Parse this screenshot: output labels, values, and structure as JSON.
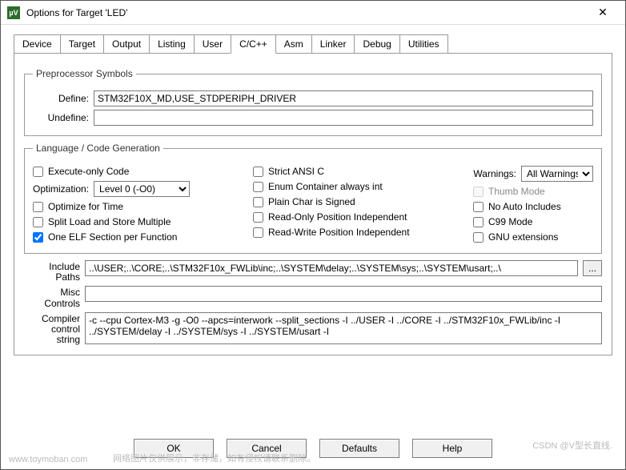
{
  "window": {
    "title": "Options for Target 'LED'"
  },
  "tabs": [
    "Device",
    "Target",
    "Output",
    "Listing",
    "User",
    "C/C++",
    "Asm",
    "Linker",
    "Debug",
    "Utilities"
  ],
  "active_tab": "C/C++",
  "preproc": {
    "legend": "Preprocessor Symbols",
    "define_label": "Define:",
    "define_value": "STM32F10X_MD,USE_STDPERIPH_DRIVER",
    "undefine_label": "Undefine:",
    "undefine_value": ""
  },
  "codegen": {
    "legend": "Language / Code Generation",
    "exec_only": "Execute-only Code",
    "optimization_label": "Optimization:",
    "optimization_value": "Level 0 (-O0)",
    "optimize_time": "Optimize for Time",
    "split_load": "Split Load and Store Multiple",
    "one_elf": "One ELF Section per Function",
    "strict_ansi": "Strict ANSI C",
    "enum_container": "Enum Container always int",
    "plain_char": "Plain Char is Signed",
    "ro_pi": "Read-Only Position Independent",
    "rw_pi": "Read-Write Position Independent",
    "warnings_label": "Warnings:",
    "warnings_value": "All Warnings",
    "thumb": "Thumb Mode",
    "no_auto": "No Auto Includes",
    "c99": "C99 Mode",
    "gnu": "GNU extensions"
  },
  "paths": {
    "include_label": "Include\nPaths",
    "include_value": "..\\USER;..\\CORE;..\\STM32F10x_FWLib\\inc;..\\SYSTEM\\delay;..\\SYSTEM\\sys;..\\SYSTEM\\usart;..\\",
    "misc_label": "Misc\nControls",
    "misc_value": "",
    "compiler_label": "Compiler\ncontrol\nstring",
    "compiler_value": "-c --cpu Cortex-M3 -g -O0 --apcs=interwork --split_sections -I ../USER -I ../CORE -I ../STM32F10x_FWLib/inc -I ../SYSTEM/delay -I ../SYSTEM/sys -I ../SYSTEM/usart -I"
  },
  "buttons": {
    "ok": "OK",
    "cancel": "Cancel",
    "defaults": "Defaults",
    "help": "Help"
  },
  "watermarks": {
    "w1": "www.toymoban.com",
    "w2": "网络图片仅供展示，非存储，如有侵权请联系删除。",
    "w3": "CSDN @V型长直线."
  }
}
